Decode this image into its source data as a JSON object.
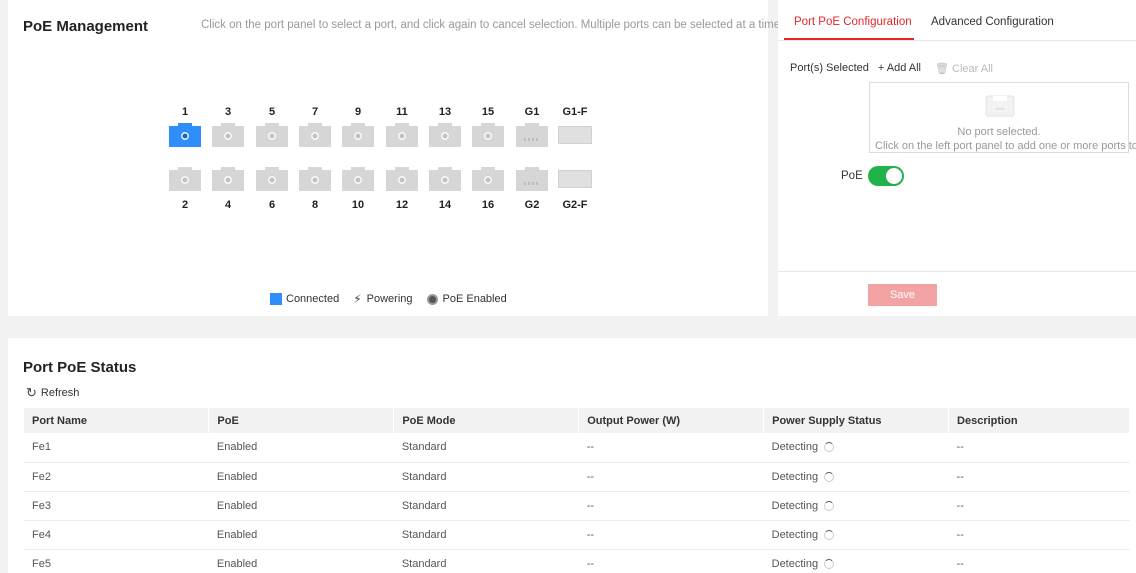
{
  "poe_management": {
    "title": "PoE Management",
    "hint": "Click on the port panel to select a port, and click again to cancel selection. Multiple ports can be selected at a time.",
    "top_labels": [
      "1",
      "3",
      "5",
      "7",
      "9",
      "11",
      "13",
      "15",
      "G1",
      "G1-F"
    ],
    "bottom_labels": [
      "2",
      "4",
      "6",
      "8",
      "10",
      "12",
      "14",
      "16",
      "G2",
      "G2-F"
    ],
    "legend": {
      "connected": "Connected",
      "powering": "Powering",
      "poe_enabled": "PoE Enabled"
    },
    "colors": {
      "connected": "#2f8ef9",
      "port_idle": "#d6d6d6"
    }
  },
  "config": {
    "tabs": [
      "Port PoE Configuration",
      "Advanced Configuration"
    ],
    "active_tab": "Port PoE Configuration",
    "ports_selected_label": "Port(s) Selected",
    "add_all": "+ Add All",
    "clear_all": "Clear All",
    "empty_line1": "No port selected.",
    "empty_line2": "Click on the left port panel to add one or more ports to",
    "poe_label": "PoE",
    "poe_enabled": true,
    "save": "Save",
    "accent": "#e72528",
    "toggle_color": "#21b24b"
  },
  "status": {
    "title": "Port PoE Status",
    "refresh": "Refresh",
    "columns": [
      "Port Name",
      "PoE",
      "PoE Mode",
      "Output Power (W)",
      "Power Supply Status",
      "Description"
    ],
    "rows": [
      [
        "Fe1",
        "Enabled",
        "Standard",
        "--",
        "Detecting",
        "--"
      ],
      [
        "Fe2",
        "Enabled",
        "Standard",
        "--",
        "Detecting",
        "--"
      ],
      [
        "Fe3",
        "Enabled",
        "Standard",
        "--",
        "Detecting",
        "--"
      ],
      [
        "Fe4",
        "Enabled",
        "Standard",
        "--",
        "Detecting",
        "--"
      ],
      [
        "Fe5",
        "Enabled",
        "Standard",
        "--",
        "Detecting",
        "--"
      ]
    ]
  }
}
